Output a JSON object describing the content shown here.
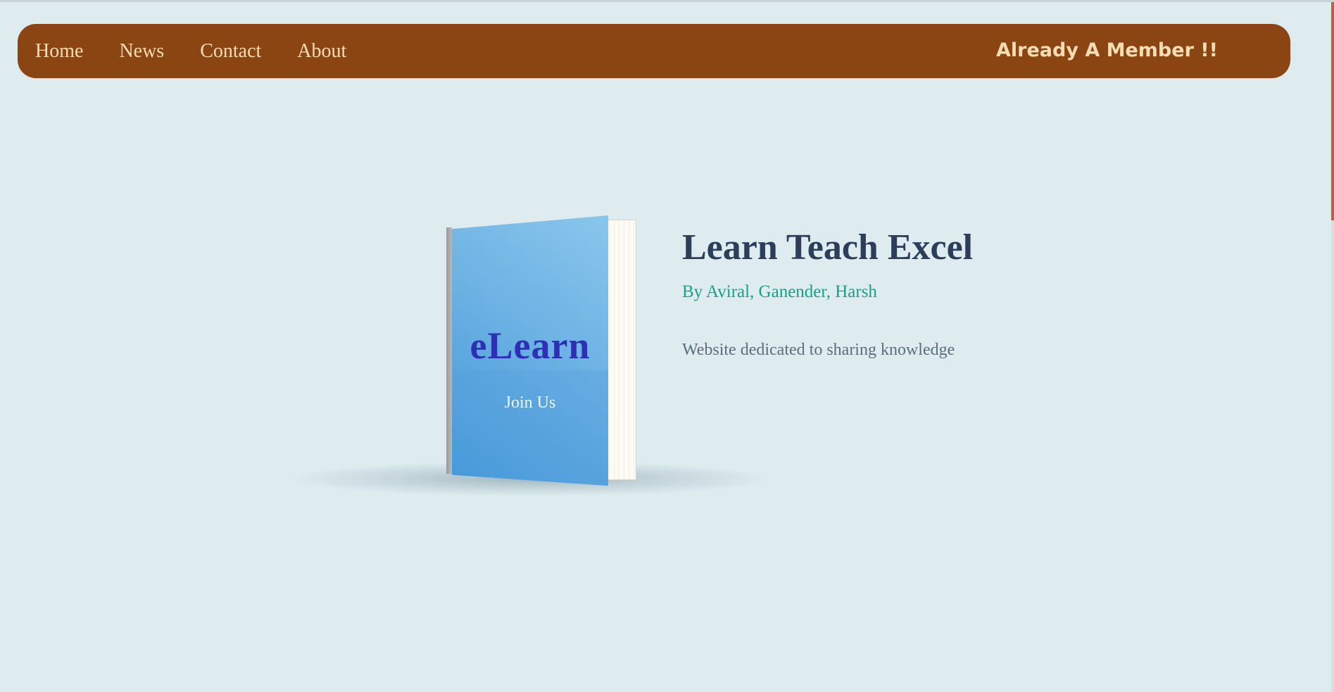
{
  "nav": {
    "links": [
      "Home",
      "News",
      "Contact",
      "About"
    ],
    "member_link": "Already A Member !!"
  },
  "book": {
    "cover_title": "eLearn",
    "cover_action": "Join Us"
  },
  "hero": {
    "title": "Learn Teach Excel",
    "authors": "By Aviral, Ganender, Harsh",
    "description": "Website dedicated to sharing knowledge"
  },
  "colors": {
    "page_background": "#deebef",
    "navbar_background": "#8b4513",
    "nav_text": "#f5deb3",
    "title_color": "#2c3e5a",
    "authors_color": "#16a085",
    "cover_title_color": "#2d2fb5"
  }
}
